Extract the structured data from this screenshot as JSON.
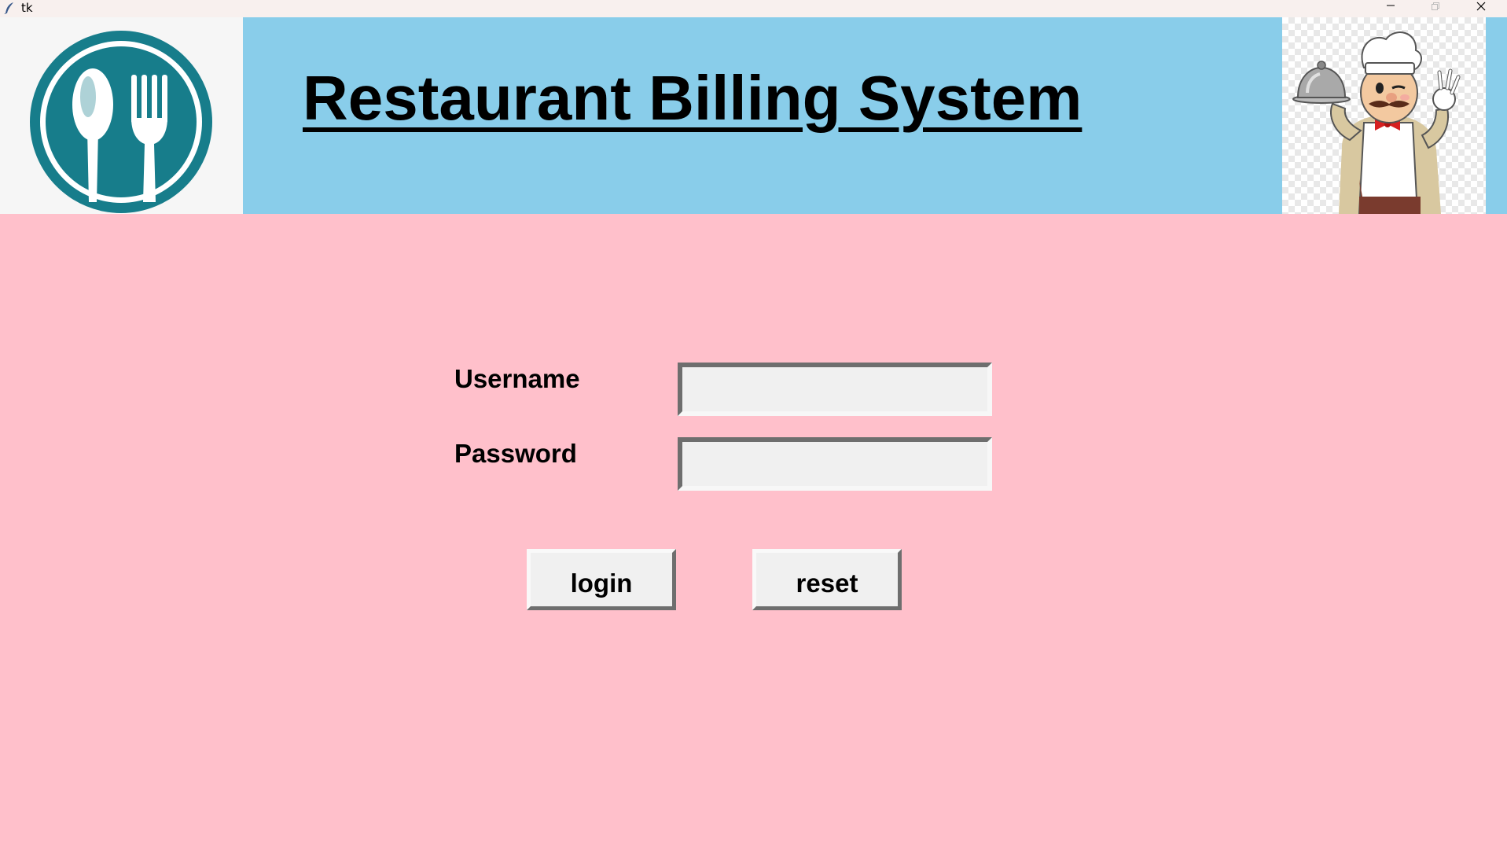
{
  "window": {
    "title": "tk",
    "controls": [
      "minimize-icon",
      "maximize-icon",
      "close-icon"
    ]
  },
  "header": {
    "title": "Restaurant Billing System",
    "logo_icon": "spoon-fork-icon",
    "mascot_icon": "chef-holding-cloche-icon"
  },
  "form": {
    "username_label": "Username",
    "username_value": "",
    "password_label": "Password",
    "password_value": ""
  },
  "buttons": {
    "login_label": "login",
    "reset_label": "reset"
  },
  "colors": {
    "background": "#ffc0cb",
    "header": "#89cdea",
    "logo_teal": "#177d8b"
  }
}
